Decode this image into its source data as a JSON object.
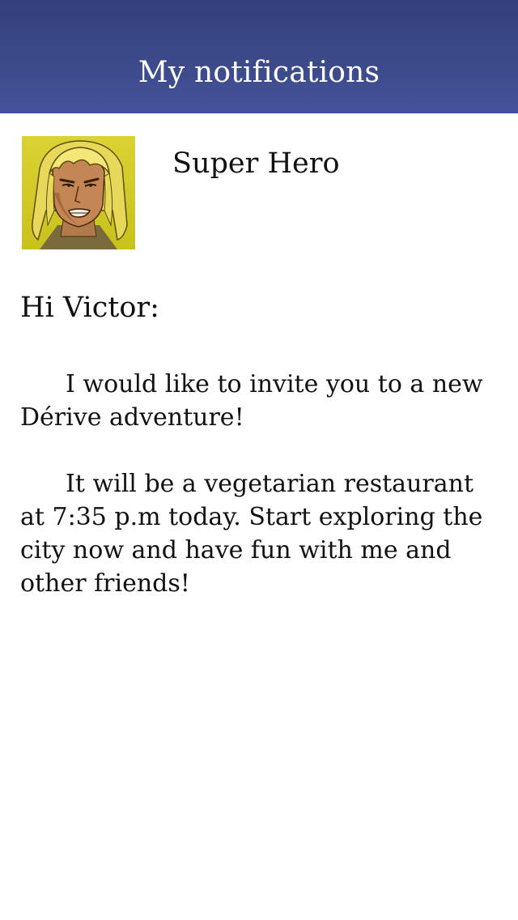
{
  "header": {
    "title": "My notifications",
    "background": "#3c4a8a"
  },
  "notification": {
    "sender": {
      "name": "Super Hero",
      "avatar_icon": "hero-avatar-icon"
    },
    "greeting": "Hi Victor:",
    "paragraphs": [
      "I would like to invite you to a new Dérive adventure!",
      "It will be a vegetarian restaurant at 7:35 p.m today. Start exploring the city now and have fun with me and other friends!"
    ]
  }
}
